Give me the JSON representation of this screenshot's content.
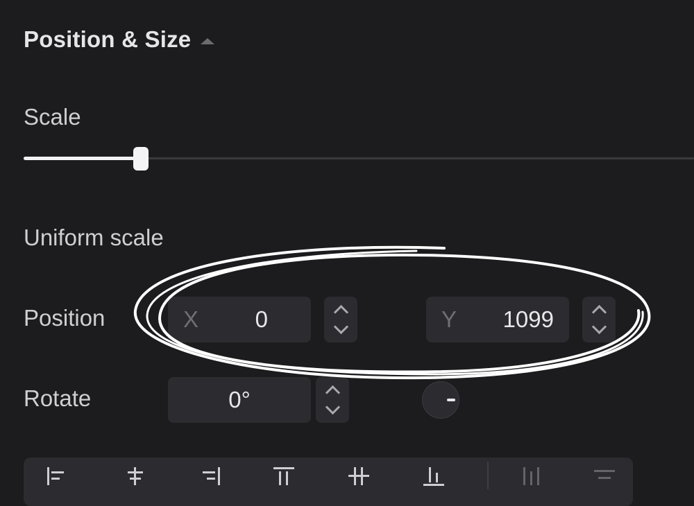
{
  "section": {
    "title": "Position & Size"
  },
  "scale": {
    "label": "Scale",
    "value_fraction": 0.17
  },
  "uniform_scale": {
    "label": "Uniform scale"
  },
  "position": {
    "label": "Position",
    "x": {
      "axis": "X",
      "value": "0"
    },
    "y": {
      "axis": "Y",
      "value": "1099"
    }
  },
  "rotate": {
    "label": "Rotate",
    "value": "0°"
  },
  "icons": {
    "section_toggle": "caret-up-icon",
    "stepper": "up-down-chevron-icon",
    "rotation_dial": "rotation-dial-icon",
    "align": [
      "align-left-icon",
      "align-center-horizontal-icon",
      "align-right-icon",
      "align-top-icon",
      "align-center-vertical-icon",
      "align-bottom-icon",
      "distribute-horizontal-icon",
      "distribute-vertical-icon"
    ]
  },
  "colors": {
    "background": "#1c1c1e",
    "field": "#2c2c30",
    "annotation": "#ffffff"
  }
}
